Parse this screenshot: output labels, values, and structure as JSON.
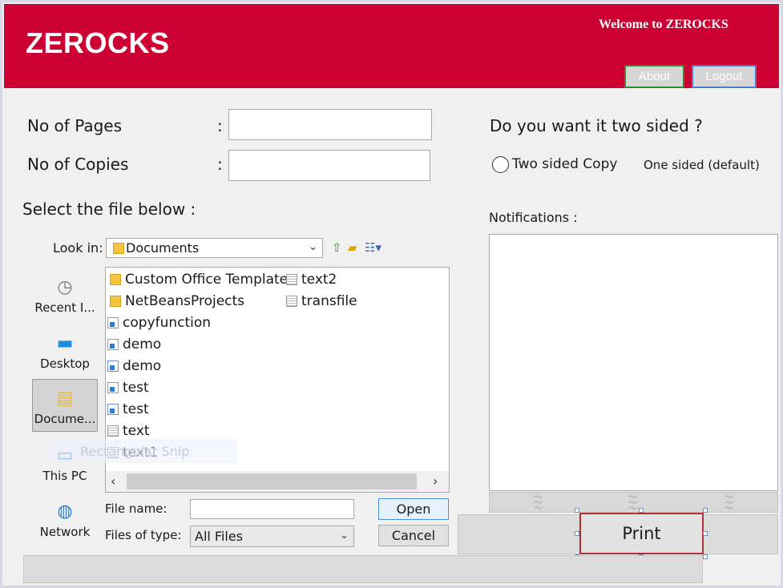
{
  "header": {
    "brand": "ZEROCKS",
    "welcome": "Welcome to ZEROCKS",
    "about_label": "About",
    "logout_label": "Logout"
  },
  "form": {
    "pages_label": "No of Pages",
    "copies_label": "No of Copies",
    "colon": ":",
    "pages_value": "",
    "copies_value": "",
    "select_file_label": "Select the file below :"
  },
  "sided": {
    "question": "Do you want it two sided ?",
    "two_sided_label": "Two sided Copy",
    "two_sided_checked": false,
    "one_sided_label": "One sided (default)"
  },
  "notifications": {
    "label": "Notifications :",
    "content": ""
  },
  "file_chooser": {
    "look_in_label": "Look in:",
    "look_in_value": "Documents",
    "places": [
      {
        "label": "Recent I...",
        "icon": "recent-items-icon"
      },
      {
        "label": "Desktop",
        "icon": "desktop-icon"
      },
      {
        "label": "Docume...",
        "icon": "documents-icon"
      },
      {
        "label": "This PC",
        "icon": "computer-icon"
      },
      {
        "label": "Network",
        "icon": "network-icon"
      }
    ],
    "files": [
      {
        "name": "Custom Office Templates",
        "type": "folder"
      },
      {
        "name": "NetBeansProjects",
        "type": "folder"
      },
      {
        "name": "copyfunction",
        "type": "jar"
      },
      {
        "name": "demo",
        "type": "jar"
      },
      {
        "name": "demo",
        "type": "java"
      },
      {
        "name": "test",
        "type": "jar"
      },
      {
        "name": "test",
        "type": "java"
      },
      {
        "name": "text",
        "type": "doc"
      },
      {
        "name": "text1",
        "type": "doc"
      },
      {
        "name": "text2",
        "type": "doc"
      },
      {
        "name": "transfile",
        "type": "doc"
      }
    ],
    "file_name_label": "File name:",
    "file_name_value": "",
    "file_type_label": "Files of type:",
    "file_type_value": "All Files",
    "open_label": "Open",
    "cancel_label": "Cancel",
    "snip_overlay": "Rectangular Snip"
  },
  "print_label": "Print",
  "colors": {
    "header": "#cc0033",
    "print_border": "#b03030"
  }
}
